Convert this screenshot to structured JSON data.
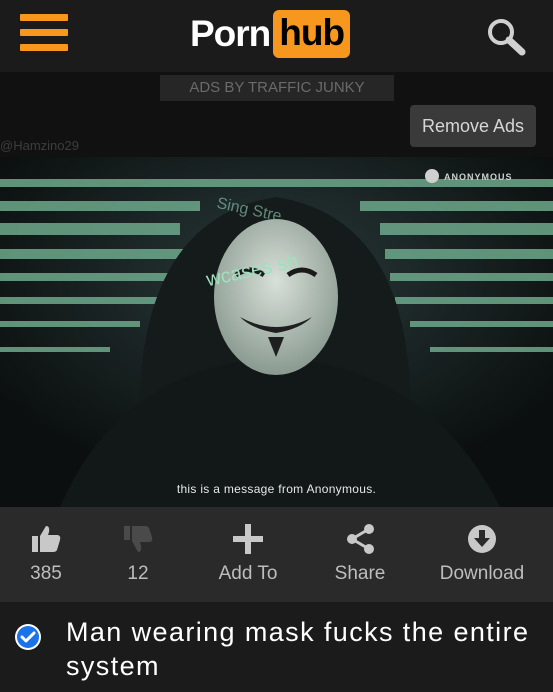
{
  "header": {
    "logo_left": "Porn",
    "logo_right": "hub",
    "menu_icon": "hamburger-icon",
    "search_icon": "search-icon",
    "brand_color": "#f7971d"
  },
  "ads": {
    "label": "ADS BY TRAFFIC JUNKY",
    "remove_label": "Remove Ads"
  },
  "watermark": "@Hamzino29",
  "video": {
    "overlay_text_1": "wcases sh",
    "overlay_text_2": "Sing Stre",
    "channel_badge": "ANONYMOUS",
    "subtitle": "this is a message from Anonymous."
  },
  "actions": [
    {
      "icon": "thumbs-up-icon",
      "label": "385"
    },
    {
      "icon": "thumbs-down-icon",
      "label": "12"
    },
    {
      "icon": "plus-icon",
      "label": "Add To"
    },
    {
      "icon": "share-icon",
      "label": "Share"
    },
    {
      "icon": "download-icon",
      "label": "Download"
    }
  ],
  "title": {
    "verified_icon": "verified-check-icon",
    "text": "Man wearing mask fucks the entire system"
  }
}
